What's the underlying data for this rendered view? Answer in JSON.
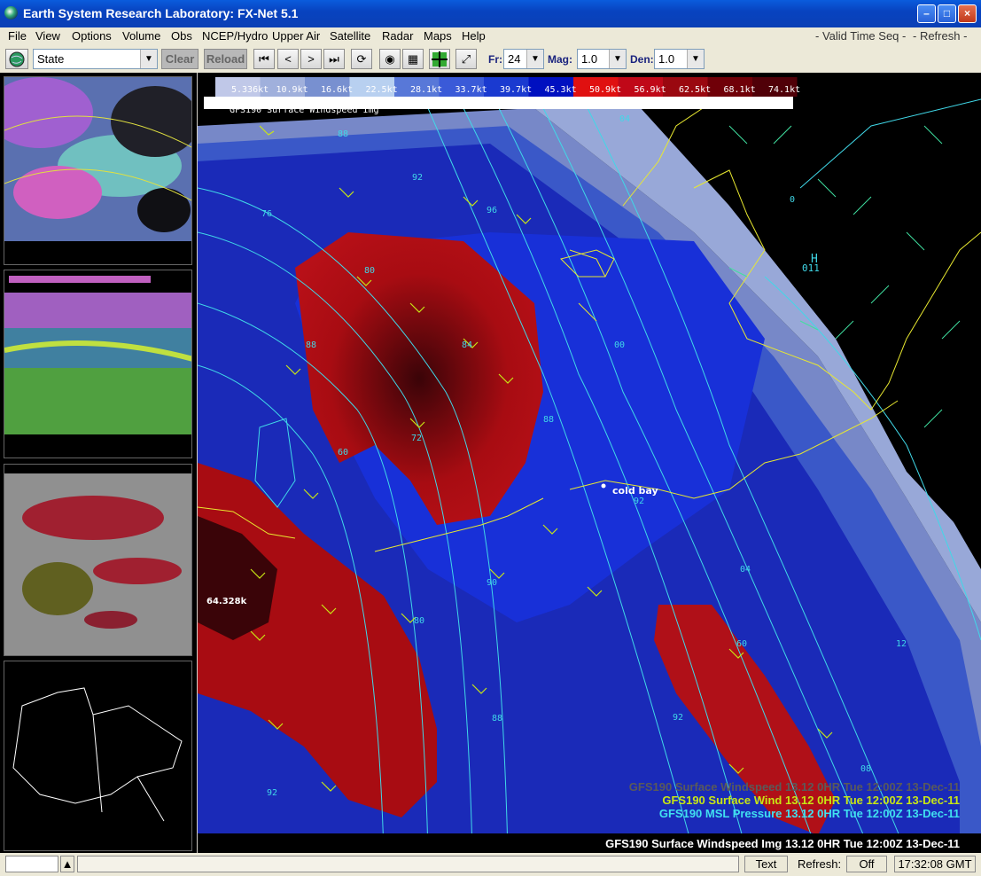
{
  "window": {
    "title": "Earth System Research Laboratory: FX-Net 5.1"
  },
  "menu": [
    "File",
    "View",
    "Options",
    "Volume",
    "Obs",
    "NCEP/Hydro",
    "Upper Air",
    "Satellite",
    "Radar",
    "Maps",
    "Help"
  ],
  "menu_right": {
    "valid_time": "- Valid Time Seq -",
    "refresh": "- Refresh -"
  },
  "toolbar": {
    "region_value": "State",
    "clear_label": "Clear",
    "reload_label": "Reload",
    "fr_label": "Fr:",
    "fr_value": "24",
    "mag_label": "Mag:",
    "mag_value": "1.0",
    "den_label": "Den:",
    "den_value": "1.0"
  },
  "legend": {
    "ticks": [
      "5.336kt",
      "10.9kt",
      "16.6kt",
      "22.5kt",
      "28.1kt",
      "33.7kt",
      "39.7kt",
      "45.3kt",
      "50.9kt",
      "56.9kt",
      "62.5kt",
      "68.1kt",
      "74.1kt"
    ],
    "caption": "GFS190 Surface Windspeed Img"
  },
  "map": {
    "station_label": "cold bay",
    "value_readout": "64.328k",
    "high_label": "H",
    "high_value": "011",
    "contour_labels": [
      "88",
      "92",
      "96",
      "76",
      "80",
      "84",
      "88",
      "00",
      "72",
      "60",
      "88",
      "92",
      "84",
      "80",
      "76",
      "90",
      "88",
      "60",
      "92",
      "08",
      "04",
      "04",
      "12",
      "92",
      "0"
    ],
    "layer_lines": [
      {
        "text": "GFS190 Surface Windspeed  13.12  0HR Tue 12:00Z 13-Dec-11",
        "color": "#5a5a5a"
      },
      {
        "text": "GFS190 Surface Wind  13.12  0HR Tue 12:00Z 13-Dec-11",
        "color": "#c8e614"
      },
      {
        "text": "GFS190 MSL Pressure  13.12  0HR Tue 12:00Z 13-Dec-11",
        "color": "#40e0f0"
      }
    ],
    "bottom_title": "GFS190 Surface Windspeed Img 13.12  0HR Tue 12:00Z 13-Dec-11"
  },
  "status": {
    "text_button": "Text",
    "refresh_label": "Refresh:",
    "refresh_value": "Off",
    "time": "17:32:08 GMT"
  },
  "colors": {
    "legend": [
      "#c0c8e8",
      "#a0b0dc",
      "#7890d0",
      "#b8d0f0",
      "#5878d8",
      "#3a5ad8",
      "#1a3ad0",
      "#0010c0",
      "#e01010",
      "#c00818",
      "#9a0810",
      "#700008",
      "#500008"
    ],
    "wind_red": "#b01010",
    "wind_blue": "#1830c0",
    "coast": "#e8e830",
    "isobar": "#40d8e8"
  }
}
